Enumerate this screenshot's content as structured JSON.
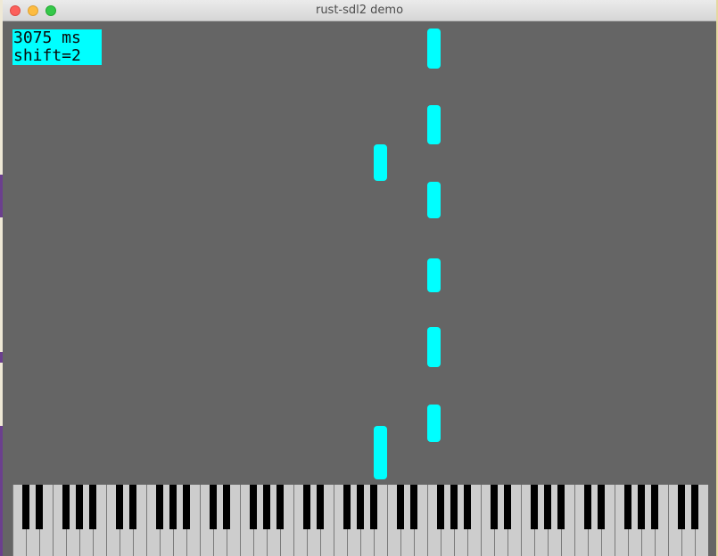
{
  "window": {
    "title": "rust-sdl2 demo"
  },
  "hud": {
    "line1": "3075 ms",
    "line2": "shift=2"
  },
  "colors": {
    "canvas_bg": "#656565",
    "note": "#00ffff",
    "hud_bg": "#00ffff",
    "white_key": "#cdcdcd",
    "black_key": "#000000",
    "close": "#fc605c",
    "minimize": "#fdbc40",
    "maximize": "#34c84a"
  },
  "keyboard": {
    "white_key_count": 52,
    "black_key_count": 36
  }
}
